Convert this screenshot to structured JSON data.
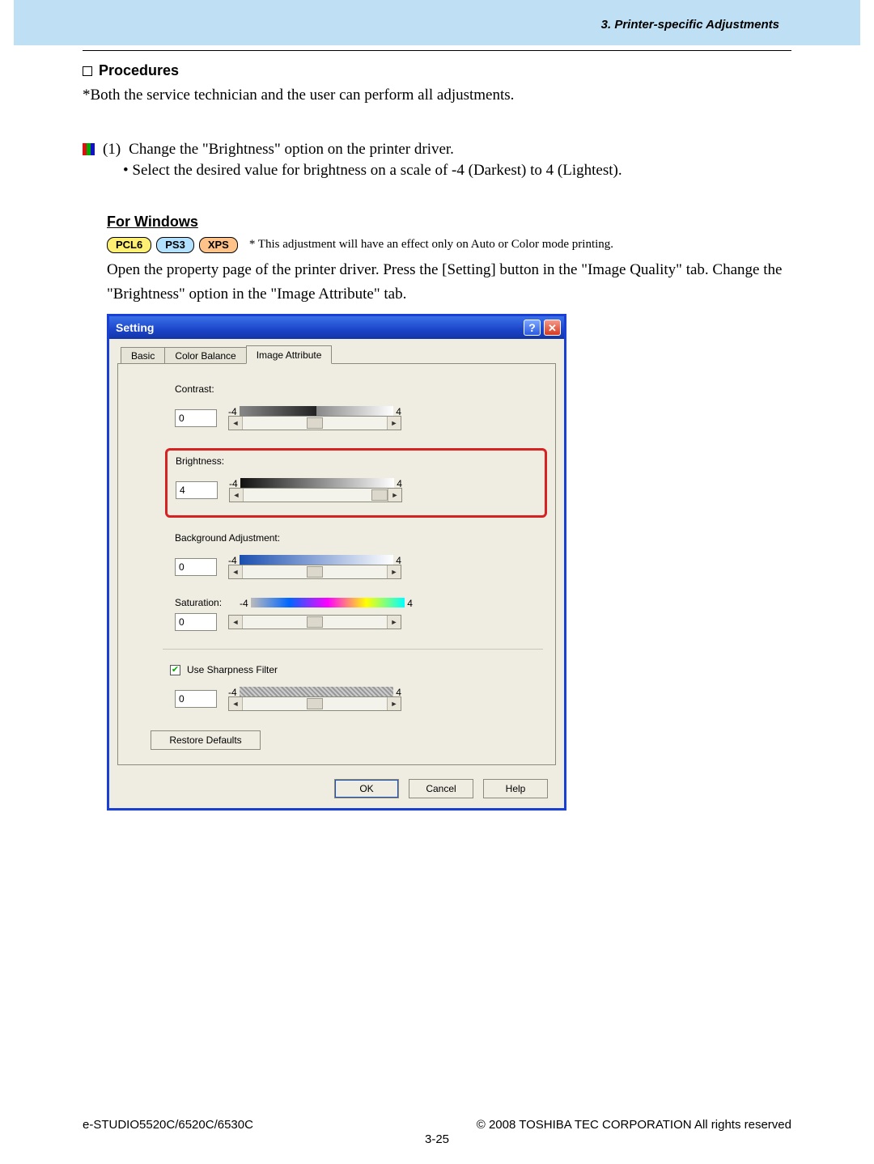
{
  "header": {
    "section": "3. Printer-specific Adjustments"
  },
  "procedures": {
    "title": "Procedures",
    "note": "*Both the service technician and the user can perform all adjustments."
  },
  "step1": {
    "num": "(1)",
    "text": "Change the \"Brightness\" option on the printer driver.",
    "bullet": "• Select the desired value for brightness on a scale of -4 (Darkest) to 4 (Lightest)."
  },
  "windows": {
    "title": "For Windows",
    "tags": {
      "pcl6": "PCL6",
      "ps3": "PS3",
      "xps": "XPS"
    },
    "tagnote": "* This adjustment will have an effect only on Auto or Color mode printing.",
    "para": "Open the property page of the printer driver.  Press the [Setting] button in the \"Image Quality\" tab.  Change the \"Brightness\" option in the \"Image Attribute\" tab."
  },
  "dialog": {
    "title": "Setting",
    "tabs": {
      "basic": "Basic",
      "color_balance": "Color Balance",
      "image_attribute": "Image Attribute"
    },
    "labels": {
      "contrast": "Contrast:",
      "brightness": "Brightness:",
      "background": "Background Adjustment:",
      "saturation": "Saturation:",
      "use_sharpness": "Use Sharpness Filter",
      "restore": "Restore Defaults",
      "min": "-4",
      "max": "4"
    },
    "values": {
      "contrast": "0",
      "brightness": "4",
      "background": "0",
      "saturation": "0",
      "sharpness": "0",
      "sharp_checked": true
    },
    "buttons": {
      "ok": "OK",
      "cancel": "Cancel",
      "help": "Help"
    }
  },
  "footer": {
    "left": "e-STUDIO5520C/6520C/6530C",
    "right": "© 2008 TOSHIBA TEC CORPORATION All rights reserved",
    "center": "3-25"
  }
}
